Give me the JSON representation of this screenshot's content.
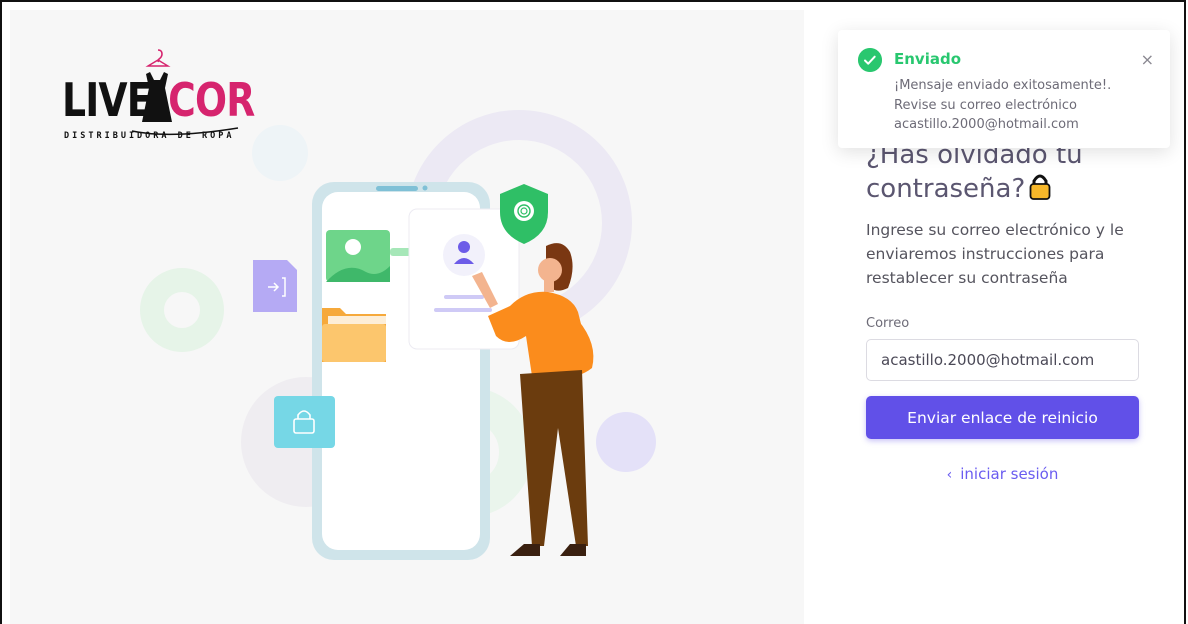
{
  "brand": {
    "logo_text_part1": "LIVE",
    "logo_text_part2": "COR",
    "logo_subtitle": "DISTRIBUIDORA DE ROPA"
  },
  "colors": {
    "primary": "#6150e8",
    "success": "#28c76f",
    "brand_pink": "#d6246e",
    "illustration_orange": "#fb8c1c"
  },
  "toast": {
    "title": "Enviado",
    "message_lines": [
      "¡Mensaje enviado exitosamente!.",
      "Revise su correo electrónico",
      "acastillo.2000@hotmail.com"
    ],
    "close_label": "×",
    "icon": "check-circle-icon"
  },
  "form": {
    "title_line1": "¿Has olvidado tu",
    "title_line2": "contraseña?",
    "title_icon": "lock-emoji-icon",
    "description": "Ingrese su correo electrónico y le enviaremos instrucciones para restablecer su contraseña",
    "email_label": "Correo",
    "email_value": "acastillo.2000@hotmail.com",
    "submit_label": "Enviar enlace de reinicio",
    "back_label": "iniciar sesión",
    "back_icon": "chevron-left-icon"
  }
}
